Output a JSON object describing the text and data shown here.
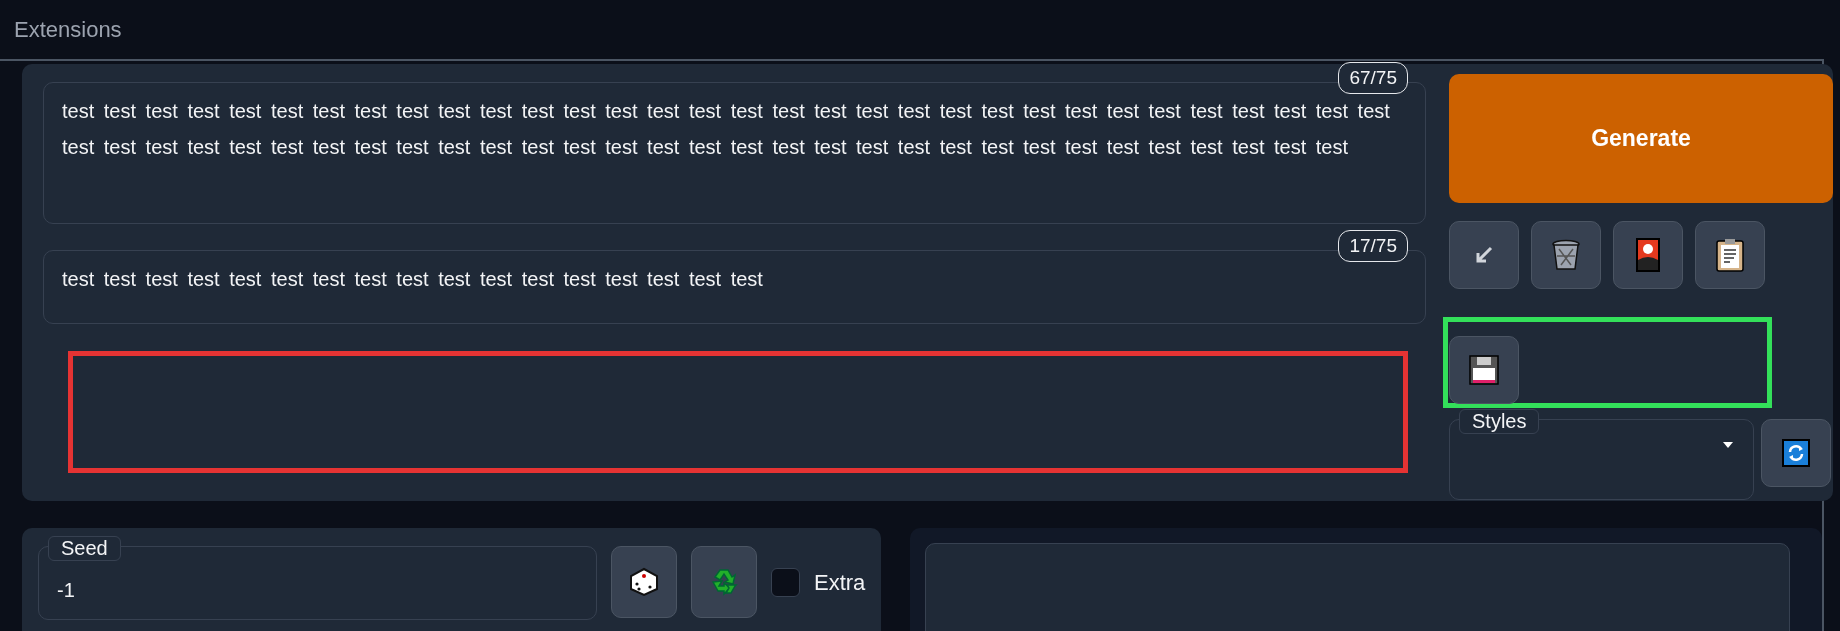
{
  "header": {
    "title": "Extensions"
  },
  "prompts": [
    {
      "value": "test test test test test test test test test test test test test test test test test test test test test test test test test test test test test test test test test test test test test test test test test test test test test test test test test test test test test test test test test test test test test test test",
      "counter": "67/75"
    },
    {
      "value": "test test test test test test test test test test test test test test test test test",
      "counter": "17/75"
    }
  ],
  "generate": {
    "label": "Generate"
  },
  "highlights": [
    {
      "color": "#e53333"
    },
    {
      "color": "#33e05a"
    }
  ],
  "styles": {
    "label": "Styles"
  },
  "seed": {
    "label": "Seed",
    "value": "-1"
  },
  "extra": {
    "label": "Extra",
    "checked": false
  }
}
